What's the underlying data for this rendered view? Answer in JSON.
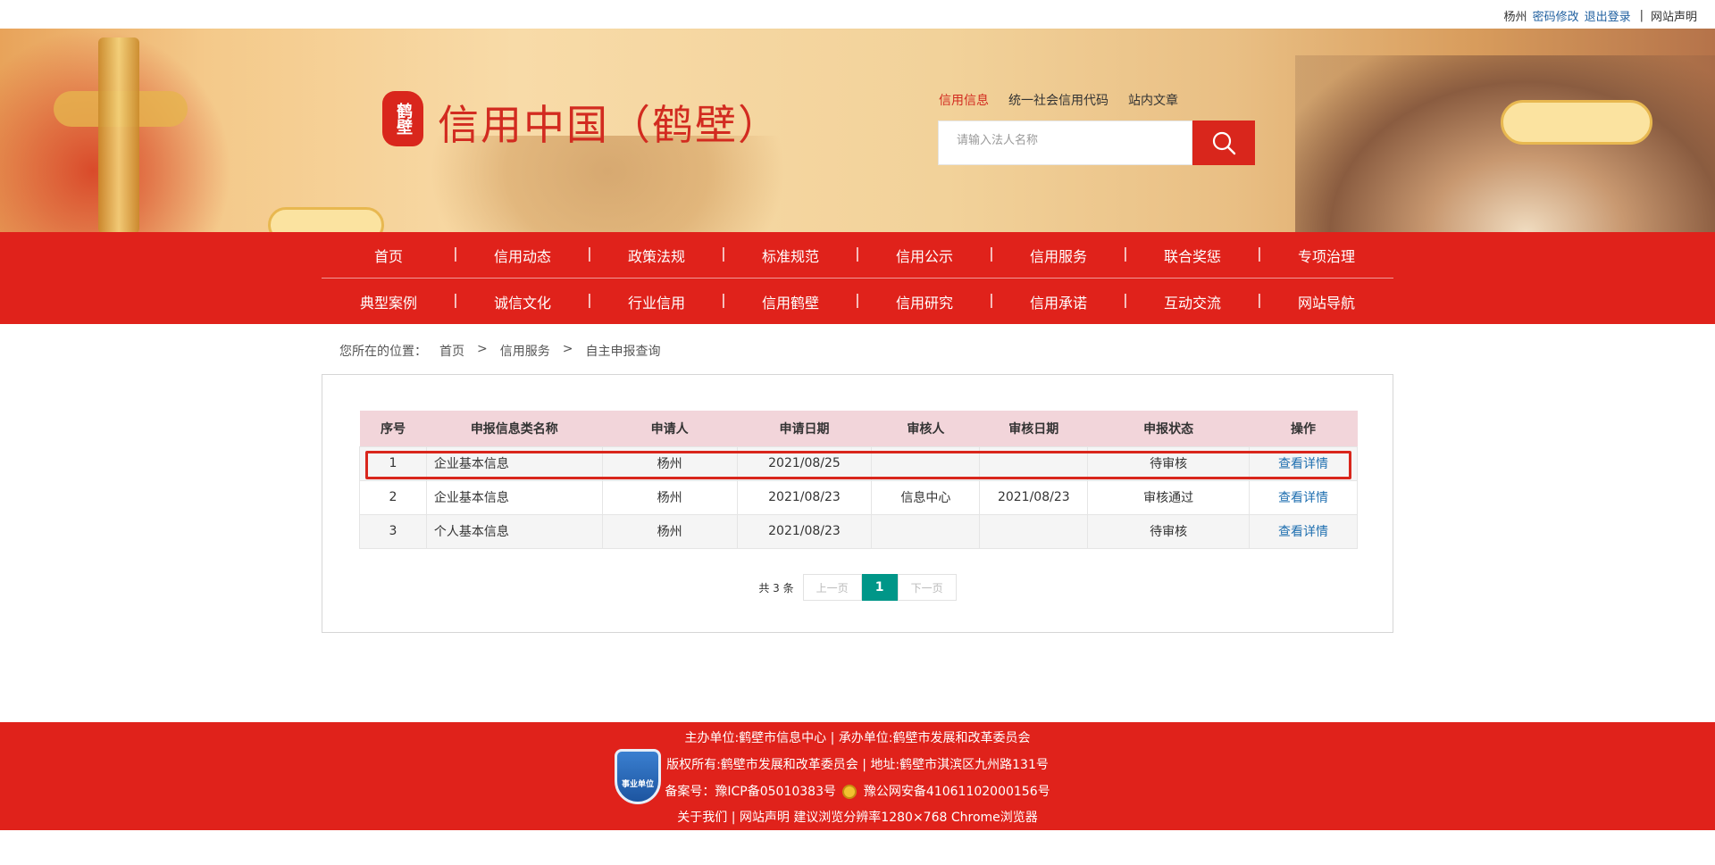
{
  "topbar": {
    "user": "杨州",
    "change_password": "密码修改",
    "logout": "退出登录",
    "separator": "|",
    "site_statement": "网站声明"
  },
  "header": {
    "seal_text": "鹤壁",
    "title": "信用中国（鹤壁）",
    "search_tabs": [
      {
        "label": "信用信息",
        "active": true
      },
      {
        "label": "统一社会信用代码",
        "active": false
      },
      {
        "label": "站内文章",
        "active": false
      }
    ],
    "search_placeholder": "请输入法人名称"
  },
  "nav": {
    "row1": [
      "首页",
      "信用动态",
      "政策法规",
      "标准规范",
      "信用公示",
      "信用服务",
      "联合奖惩",
      "专项治理"
    ],
    "row2": [
      "典型案例",
      "诚信文化",
      "行业信用",
      "信用鹤壁",
      "信用研究",
      "信用承诺",
      "互动交流",
      "网站导航"
    ]
  },
  "breadcrumb": {
    "prefix": "您所在的位置：",
    "items": [
      "首页",
      "信用服务",
      "自主申报查询"
    ],
    "separator": ">"
  },
  "table": {
    "headers": [
      "序号",
      "申报信息类名称",
      "申请人",
      "申请日期",
      "审核人",
      "审核日期",
      "申报状态",
      "操作"
    ],
    "rows": [
      {
        "no": "1",
        "name": "企业基本信息",
        "applicant": "杨州",
        "apply_date": "2021/08/25",
        "reviewer": "",
        "review_date": "",
        "status": "待审核",
        "action": "查看详情"
      },
      {
        "no": "2",
        "name": "企业基本信息",
        "applicant": "杨州",
        "apply_date": "2021/08/23",
        "reviewer": "信息中心",
        "review_date": "2021/08/23",
        "status": "审核通过",
        "action": "查看详情"
      },
      {
        "no": "3",
        "name": "个人基本信息",
        "applicant": "杨州",
        "apply_date": "2021/08/23",
        "reviewer": "",
        "review_date": "",
        "status": "待审核",
        "action": "查看详情"
      }
    ]
  },
  "pagination": {
    "total": "共 3 条",
    "prev": "上一页",
    "current": "1",
    "next": "下一页"
  },
  "footer": {
    "badge_text": "事业单位",
    "host": "主办单位:鹤壁市信息中心",
    "organizer": "承办单位:鹤壁市发展和改革委员会",
    "copyright": "版权所有:鹤壁市发展和改革委员会",
    "address": "地址:鹤壁市淇滨区九州路131号",
    "icp": "备案号：豫ICP备05010383号",
    "police": "豫公网安备41061102000156号",
    "about": "关于我们",
    "statement": "网站声明",
    "browser_tip": "建议浏览分辨率1280×768 Chrome浏览器",
    "sep": "|"
  },
  "colors": {
    "brand_red": "#e0221b",
    "link_blue": "#1f6fb0",
    "pager_active": "#009688",
    "table_header": "#f2d5da"
  },
  "icons": [
    "search-icon",
    "police-emblem-icon",
    "institution-badge-icon"
  ]
}
